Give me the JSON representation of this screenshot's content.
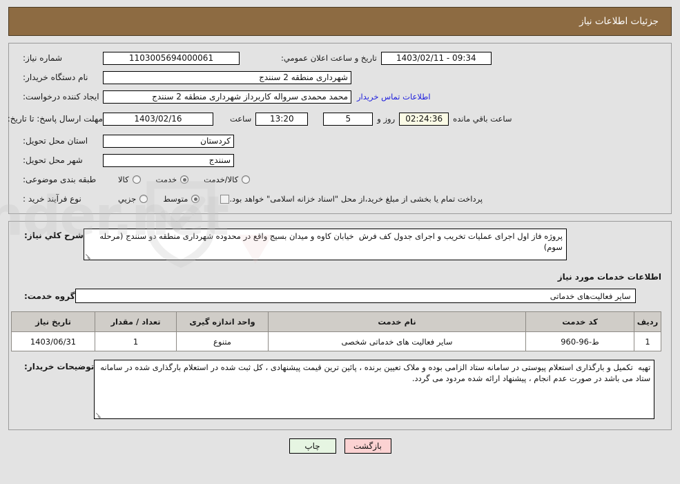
{
  "header": {
    "title": "جزئیات اطلاعات نیاز"
  },
  "form": {
    "need_number": {
      "label": "شماره نیاز:",
      "value": "1103005694000061"
    },
    "buyer_org": {
      "label": "نام دستگاه خریدار:",
      "value": "شهرداری منطقه 2 سنندج"
    },
    "request_creator": {
      "label": "ایجاد کننده درخواست:",
      "value": "محمد محمدی سرواله کاربرداز شهرداری منطقه 2 سنندج"
    },
    "deadline": {
      "label": "مهلت ارسال پاسخ: تا تاریخ:",
      "value": "1403/02/16"
    },
    "deadline_time": {
      "label": "ساعت",
      "value": "13:20"
    },
    "days_left": {
      "value": "5",
      "suffix": "روز و"
    },
    "time_left": {
      "value": "02:24:36",
      "suffix": "ساعت باقي مانده"
    },
    "public_announce": {
      "label": "تاریخ و ساعت اعلان عمومي:",
      "value": "1403/02/11 - 09:34"
    },
    "contact_link": "اطلاعات تماس خریدار",
    "province": {
      "label": "استان محل تحویل:",
      "value": "کردستان"
    },
    "city": {
      "label": "شهر محل تحویل:",
      "value": "سنندج"
    },
    "category": {
      "label": "طبقه بندی موضوعی:",
      "options": [
        {
          "label": "کالا",
          "selected": false
        },
        {
          "label": "خدمت",
          "selected": true
        },
        {
          "label": "کالا/خدمت",
          "selected": false
        }
      ]
    },
    "purchase_type": {
      "label": "نوع فرآیند خرید :",
      "options": [
        {
          "label": "جزیي",
          "selected": false
        },
        {
          "label": "متوسط",
          "selected": true
        }
      ],
      "checkbox_label": "پرداخت تمام یا بخشی از مبلغ خرید،از محل \"اسناد خزانه اسلامی\" خواهد بود.",
      "checkbox_checked": false
    }
  },
  "description": {
    "label": "شرح کلي نیاز:",
    "value": "پروژه فاز اول اجرای عملیات تخریب و اجرای جدول کف فرش  خیابان کاوه و میدان بسیج واقع در محدوده شهرداری منطقه دو سنندج (مرحله سوم)"
  },
  "services_section": {
    "title": "اطلاعات خدمات مورد نیاز",
    "group": {
      "label": "گروه خدمت:",
      "value": "سایر فعالیت‌های خدماتی"
    },
    "table": {
      "columns": [
        "ردیف",
        "کد خدمت",
        "نام خدمت",
        "واحد اندازه گیری",
        "تعداد / مقدار",
        "تاریخ نیاز"
      ],
      "rows": [
        {
          "radif": "1",
          "code": "ط-96-960",
          "name": "سایر فعالیت های خدماتی شخصی",
          "unit": "متنوع",
          "qty": "1",
          "date": "1403/06/31"
        }
      ]
    }
  },
  "buyer_notes": {
    "label": "توضیحات خریدار:",
    "value": "تهیه  تکمیل و بارگذاری استعلام پیوستی در سامانه ستاد الزامی بوده و ملاک تعیین برنده ، پائین ترین قیمت پیشنهادی ، کل ثبت شده در استعلام بارگذاری شده در سامانه ستاد می باشد در صورت عدم انجام ، پیشنهاد ارائه شده مردود می گردد."
  },
  "footer": {
    "back_label": "بازگشت",
    "print_label": "چاپ"
  },
  "colors": {
    "header_bg": "#8d6b42",
    "page_bg": "#e3e3e3",
    "link": "#2020dd",
    "timer_bg": "#fbfbe6",
    "back_btn": "#fbd2d2",
    "print_btn": "#e6f5e2",
    "table_header": "#d0cdc8"
  }
}
